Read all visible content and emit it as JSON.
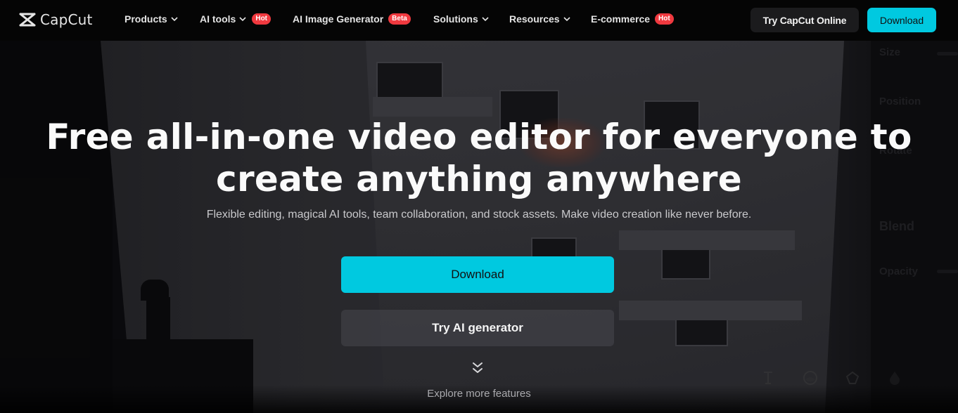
{
  "nav": {
    "logo": "CapCut",
    "items": [
      {
        "label": "Products",
        "dropdown": true,
        "badge": null
      },
      {
        "label": "AI tools",
        "dropdown": true,
        "badge": "Hot"
      },
      {
        "label": "AI Image Generator",
        "dropdown": false,
        "badge": "Beta"
      },
      {
        "label": "Solutions",
        "dropdown": true,
        "badge": null
      },
      {
        "label": "Resources",
        "dropdown": true,
        "badge": null
      },
      {
        "label": "E-commerce",
        "dropdown": false,
        "badge": "Hot"
      }
    ],
    "try_online": "Try CapCut Online",
    "download": "Download"
  },
  "hero": {
    "headline_line1": "Free all-in-one video editor for everyone to",
    "headline_line2": "create anything anywhere",
    "subtitle": "Flexible editing, magical AI tools, team collaboration, and stock assets. Make video creation like never before.",
    "download": "Download",
    "try_ai": "Try AI generator",
    "explore": "Explore more features"
  },
  "background_panel": {
    "labels": [
      "Size",
      "Position",
      "Rotate",
      "Blend",
      "Opacity"
    ]
  },
  "colors": {
    "accent": "#00c9e0",
    "badge": "#f0393f",
    "nav_bg": "#050505"
  }
}
